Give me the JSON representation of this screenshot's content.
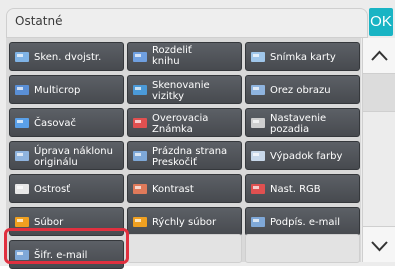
{
  "header": {
    "title": "Ostatné",
    "ok_label": "OK"
  },
  "tiles": [
    {
      "label": "Sken. dvojstr.",
      "icon": "duplex-scan-icon",
      "color": "#7fb3e6"
    },
    {
      "label": "Rozdeliť\nknihu",
      "icon": "book-divide-icon",
      "color": "#6f9fe0"
    },
    {
      "label": "Snímka karty",
      "icon": "card-shot-icon",
      "color": "#9fc6ea"
    },
    {
      "label": "Multicrop",
      "icon": "multicrop-icon",
      "color": "#5a8fd6"
    },
    {
      "label": "Skenovanie\nvizitky",
      "icon": "business-card-scan-icon",
      "color": "#4b9ad8"
    },
    {
      "label": "Orez obrazu",
      "icon": "image-crop-icon",
      "color": "#8fb4df"
    },
    {
      "label": "Časovač",
      "icon": "timer-icon",
      "color": "#5aa0e8"
    },
    {
      "label": "Overovacia\nZnámka",
      "icon": "verification-stamp-icon",
      "color": "#e05050"
    },
    {
      "label": "Nastavenie\npozadia",
      "icon": "background-setting-icon",
      "color": "#cfcfcf"
    },
    {
      "label": "Úprava náklonu\noriginálu",
      "icon": "skew-adjust-icon",
      "color": "#8fb4df"
    },
    {
      "label": "Prázdna strana\nPreskočiť",
      "icon": "blank-page-skip-icon",
      "color": "#7ea8d8"
    },
    {
      "label": "Výpadok farby",
      "icon": "color-dropout-icon",
      "color": "#c8d8ea"
    },
    {
      "label": "Ostrosť",
      "icon": "sharpness-icon",
      "color": "#e8e8e8"
    },
    {
      "label": "Kontrast",
      "icon": "contrast-icon",
      "color": "#e07a5a"
    },
    {
      "label": "Nast. RGB",
      "icon": "rgb-adjust-icon",
      "color": "#e05050"
    },
    {
      "label": "Súbor",
      "icon": "file-folder-icon",
      "color": "#f0a020"
    },
    {
      "label": "Rýchly súbor",
      "icon": "quick-file-icon",
      "color": "#f0a020"
    },
    {
      "label": "Podpís. e-mail",
      "icon": "signed-email-icon",
      "color": "#7fa8d8"
    },
    {
      "label": "Šifr. e-mail",
      "icon": "encrypted-email-icon",
      "color": "#7fa8d8"
    }
  ],
  "scrollbar": {
    "up_icon": "chevron-up-icon",
    "down_icon": "chevron-down-icon"
  },
  "accent_color": "#19b4c4",
  "highlight_color": "#e0303f"
}
